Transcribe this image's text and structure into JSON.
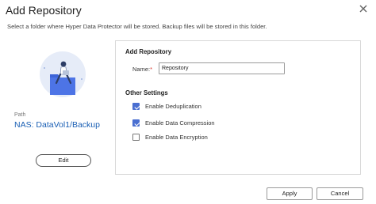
{
  "dialog": {
    "title": "Add Repository",
    "description": "Select a folder where Hyper Data Protector will be stored. Backup files will be stored in this folder.",
    "close_icon": "close-icon"
  },
  "left_panel": {
    "illustration_icon": "person-on-folder-illustration",
    "path_label": "Path",
    "path_value": "NAS: DataVol1/Backup",
    "edit_label": "Edit"
  },
  "form": {
    "section_title": "Add Repository",
    "name_label": "Name:",
    "name_required_mark": "*",
    "name_value": "Repository",
    "other_settings_title": "Other Settings",
    "options": [
      {
        "label": "Enable Deduplication",
        "checked": true
      },
      {
        "label": "Enable Data Compression",
        "checked": true
      },
      {
        "label": "Enable Data Encryption",
        "checked": false
      }
    ]
  },
  "footer": {
    "apply_label": "Apply",
    "cancel_label": "Cancel"
  },
  "colors": {
    "accent": "#4a6fd1",
    "path_text": "#1a5fb4",
    "required": "#d9342b"
  }
}
